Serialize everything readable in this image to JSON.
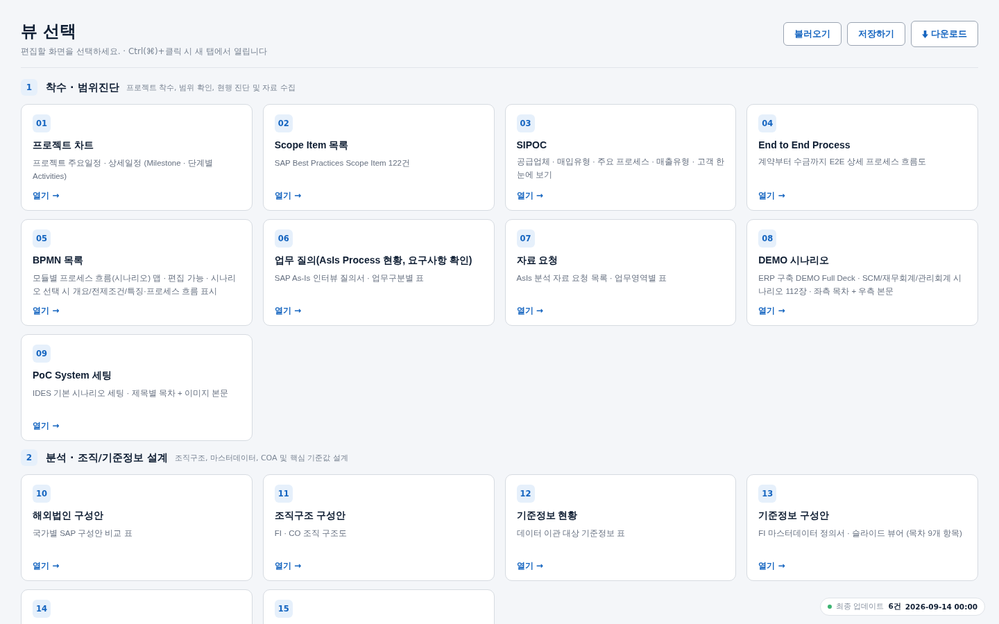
{
  "header": {
    "title": "뷰 선택",
    "subtitle": "편집할 화면을 선택하세요. · Ctrl(⌘)+클릭 시 새 탭에서 열립니다",
    "buttons": [
      {
        "label": "불러오기",
        "kind": "plain"
      },
      {
        "label": "저장하기",
        "kind": "plain"
      },
      {
        "label": "다운로드",
        "kind": "download"
      }
    ]
  },
  "sections": [
    {
      "number": "1",
      "title": "착수 · 범위진단",
      "description": "프로젝트 착수, 범위 확인, 현행 진단 및 자료 수집",
      "cards": [
        {
          "number": "01",
          "title": "프로젝트 차트",
          "description": "프로젝트 주요일정 · 상세일정 (Milestone · 단계별 Activities)",
          "link": "열기 →"
        },
        {
          "number": "02",
          "title": "Scope Item 목록",
          "description": "SAP Best Practices Scope Item 122건",
          "link": "열기 →"
        },
        {
          "number": "03",
          "title": "SIPOC",
          "description": "공급업체 · 매입유형 · 주요 프로세스 · 매출유형 · 고객 한눈에 보기",
          "link": "열기 →"
        },
        {
          "number": "04",
          "title": "End to End Process",
          "description": "계약부터 수금까지 E2E 상세 프로세스 흐름도",
          "link": "열기 →"
        },
        {
          "number": "05",
          "title": "BPMN 목록",
          "description": "모듈별 프로세스 흐름(시나리오) 맵 · 편집 가능 · 시나리오 선택 시 개요/전제조건/특징·프로세스 흐름 표시",
          "link": "열기 →"
        },
        {
          "number": "06",
          "title": "업무 질의(AsIs Process 현황, 요구사항 확인)",
          "description": "SAP As-Is 인터뷰 질의서 · 업무구분별 표",
          "link": "열기 →"
        },
        {
          "number": "07",
          "title": "자료 요청",
          "description": "AsIs 분석 자료 요청 목록 · 업무영역별 표",
          "link": "열기 →"
        },
        {
          "number": "08",
          "title": "DEMO 시나리오",
          "description": "ERP 구축 DEMO Full Deck · SCM/재무회계/관리회계 시나리오 112장 · 좌측 목차 + 우측 본문",
          "link": "열기 →"
        },
        {
          "number": "09",
          "title": "PoC System 세팅",
          "description": "IDES 기본 시나리오 세팅 · 제목별 목차 + 이미지 본문",
          "link": "열기 →"
        }
      ]
    },
    {
      "number": "2",
      "title": "분석 · 조직/기준정보 설계",
      "description": "조직구조, 마스터데이터, COA 및 핵심 기준값 설계",
      "cards": [
        {
          "number": "10",
          "title": "해외법인 구성안",
          "description": "국가별 SAP 구성안 비교 표",
          "link": "열기 →"
        },
        {
          "number": "11",
          "title": "조직구조 구성안",
          "description": "FI · CO 조직 구조도",
          "link": "열기 →"
        },
        {
          "number": "12",
          "title": "기준정보 현황",
          "description": "데이터 이관 대상 기준정보 표",
          "link": "열기 →"
        },
        {
          "number": "13",
          "title": "기준정보 구성안",
          "description": "FI 마스터데이터 정의서 · 슬라이드 뷰어 (목차 9개 항목)",
          "link": "열기 →"
        },
        {
          "number": "14"
        },
        {
          "number": "15"
        }
      ]
    }
  ],
  "status": {
    "label": "최종 업데이트",
    "count": "6건",
    "timestamp": "2026-09-14 00:00"
  }
}
